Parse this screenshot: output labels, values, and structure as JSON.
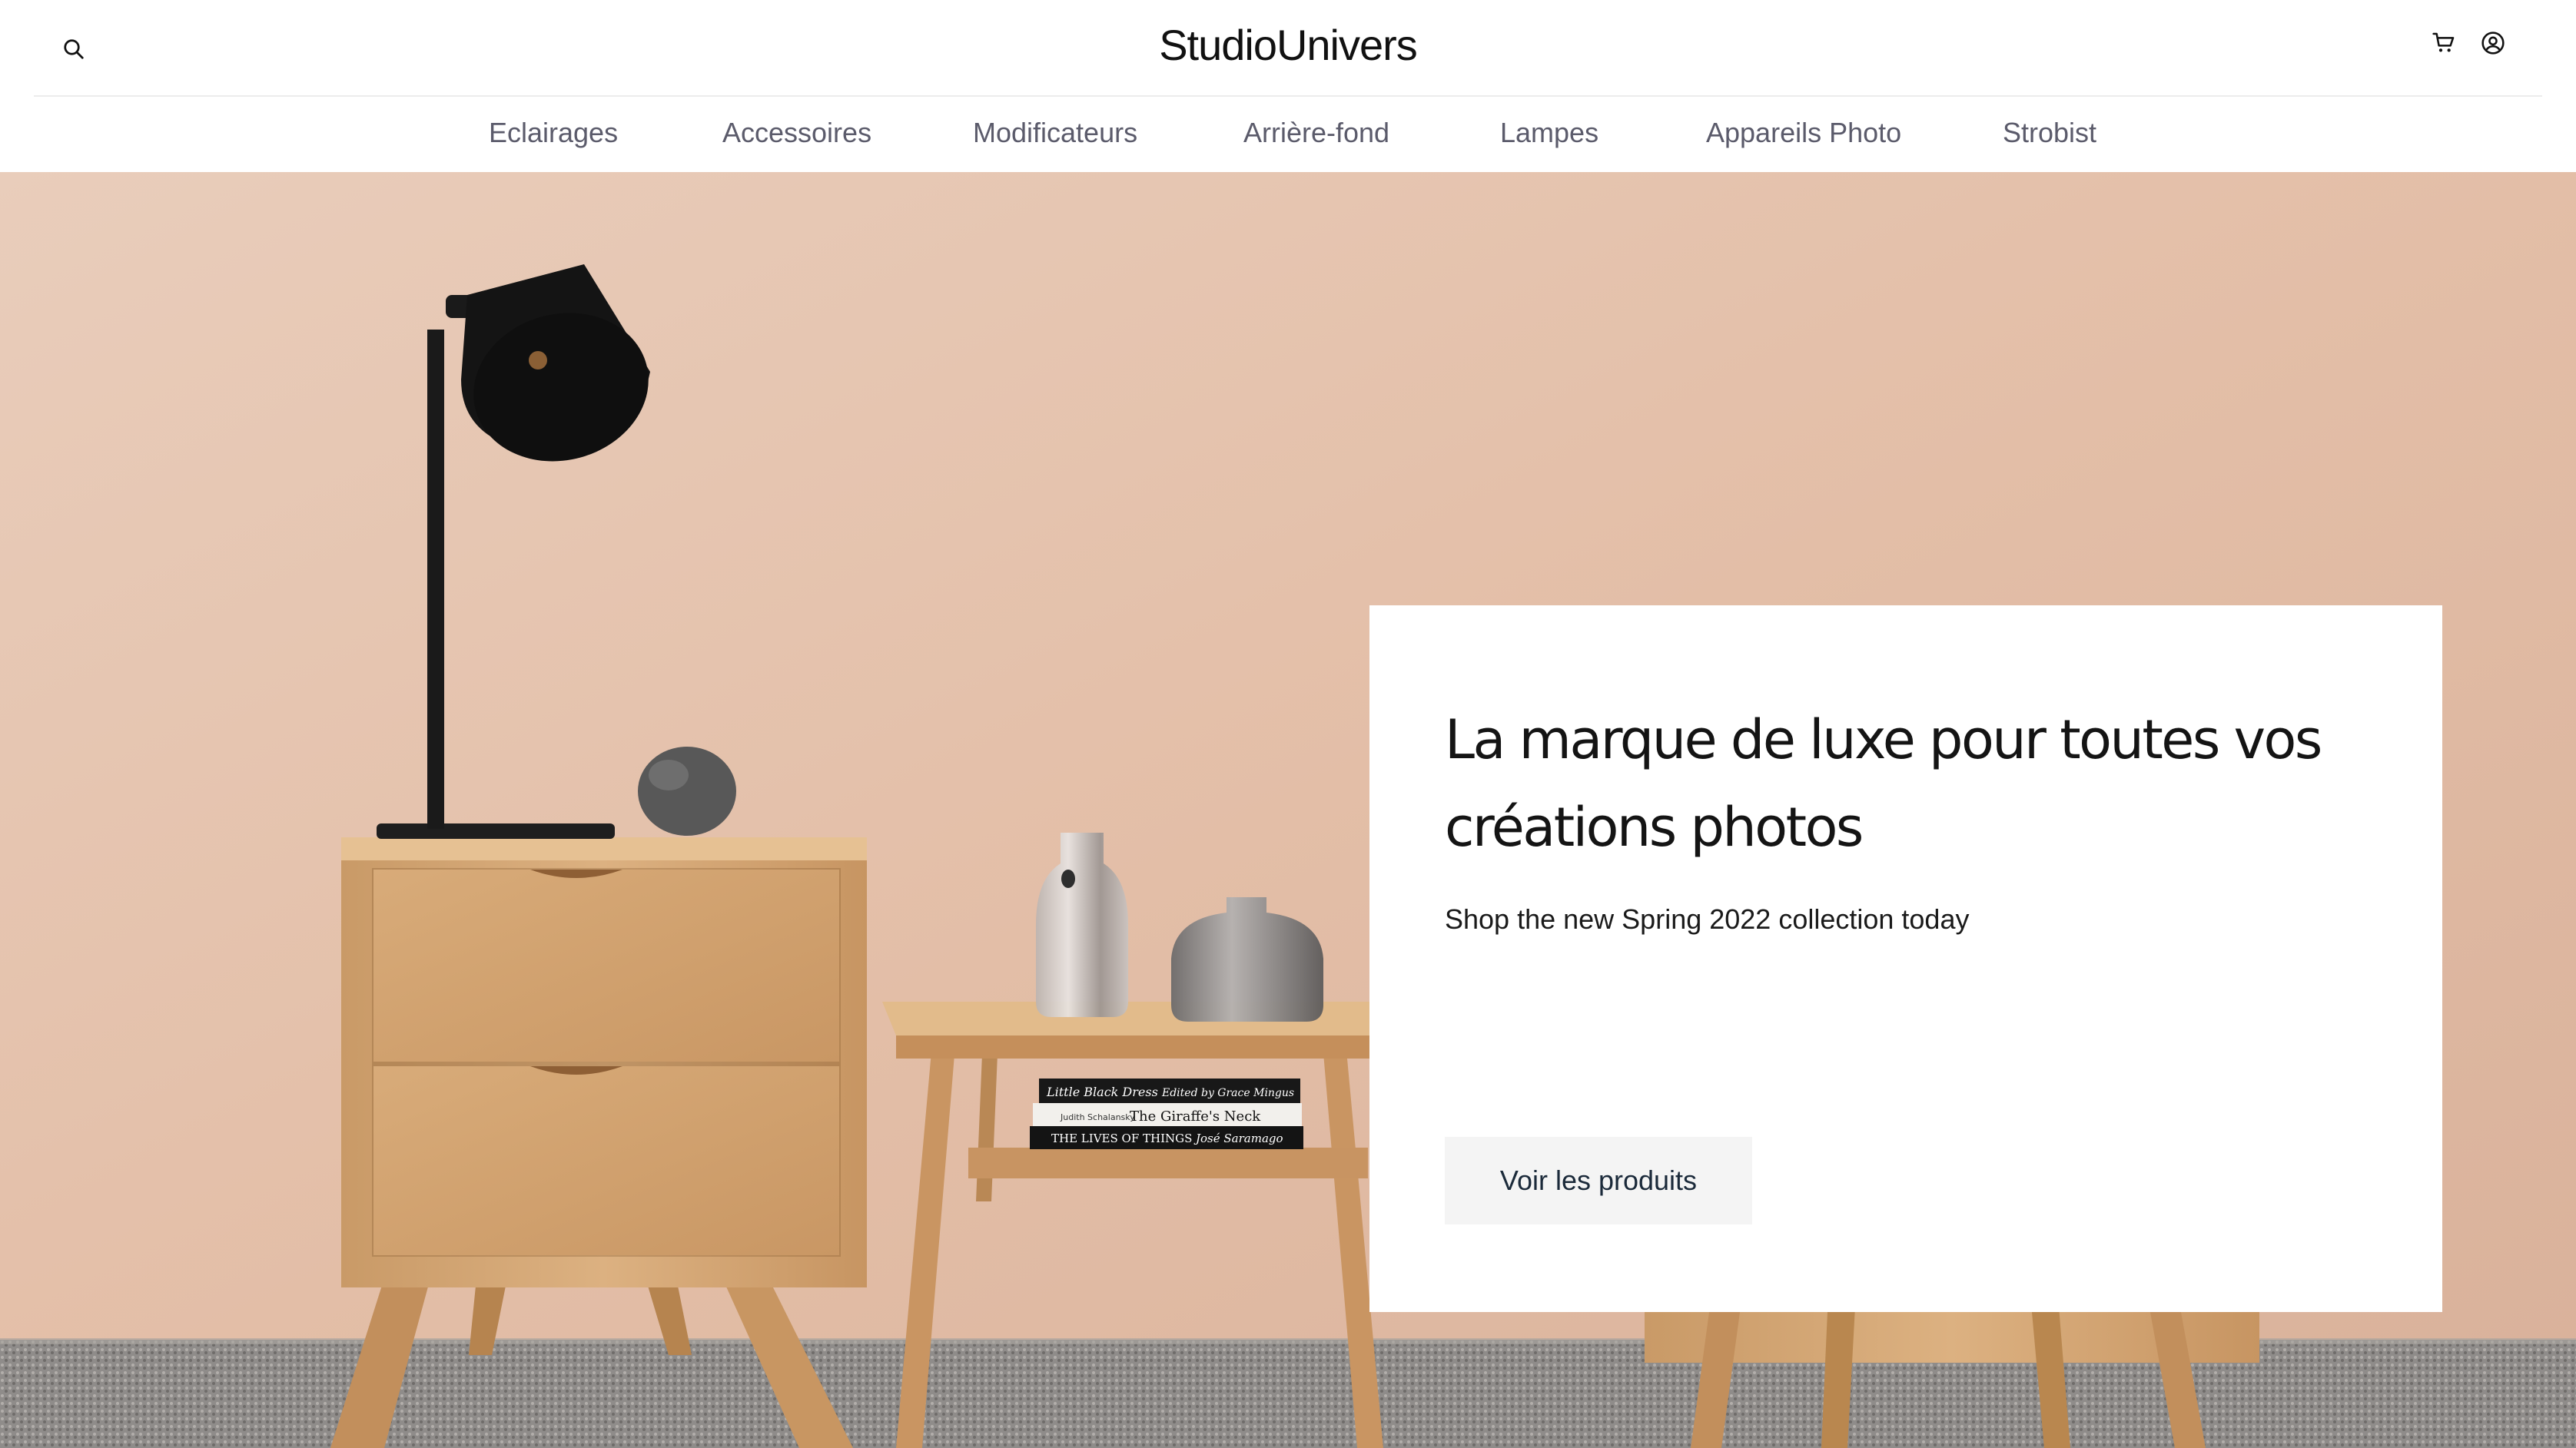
{
  "header": {
    "brand": "StudioUnivers",
    "search_icon": "search-icon",
    "cart_icon": "cart-icon",
    "account_icon": "account-icon"
  },
  "nav": {
    "items": [
      {
        "label": "Eclairages"
      },
      {
        "label": "Accessoires"
      },
      {
        "label": "Modificateurs"
      },
      {
        "label": "Arrière-fond"
      },
      {
        "label": "Lampes"
      },
      {
        "label": "Appareils Photo"
      },
      {
        "label": "Strobist"
      }
    ]
  },
  "hero": {
    "title": "La marque de luxe pour toutes vos créations photos",
    "subtitle": "Shop the new Spring 2022 collection today",
    "cta_label": "Voir les produits",
    "books": [
      {
        "title": "Little Black Dress",
        "author": "Edited by Grace Mingus"
      },
      {
        "title": "The Giraffe's Neck",
        "author": "Judith Schalansky"
      },
      {
        "title": "THE LIVES OF THINGS",
        "author": "José Saramago"
      }
    ]
  },
  "colors": {
    "wall": "#e6c6b2",
    "panel": "#ffffff",
    "nav_text": "#5b5b6b",
    "cta_bg": "#f4f4f4",
    "cta_text": "#1b2a3a"
  }
}
